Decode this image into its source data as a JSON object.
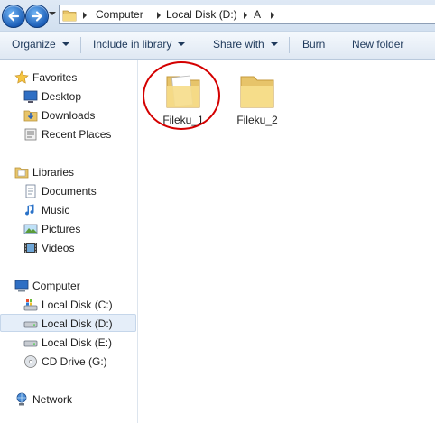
{
  "address_bar": {
    "breadcrumbs": [
      "Computer",
      "Local Disk (D:)",
      "A"
    ]
  },
  "command_bar": {
    "organize": "Organize",
    "include_in_library": "Include in library",
    "share_with": "Share with",
    "burn": "Burn",
    "new_folder": "New folder"
  },
  "nav_pane": {
    "favorites": {
      "label": "Favorites",
      "items": [
        "Desktop",
        "Downloads",
        "Recent Places"
      ]
    },
    "libraries": {
      "label": "Libraries",
      "items": [
        "Documents",
        "Music",
        "Pictures",
        "Videos"
      ]
    },
    "computer": {
      "label": "Computer",
      "items": [
        "Local Disk (C:)",
        "Local Disk (D:)",
        "Local Disk (E:)",
        "CD Drive (G:)"
      ],
      "selected": "Local Disk (D:)"
    },
    "network": {
      "label": "Network"
    }
  },
  "files": [
    {
      "name": "Fileku_1",
      "highlighted": true,
      "icon": "folder-with-document-icon"
    },
    {
      "name": "Fileku_2",
      "highlighted": false,
      "icon": "folder-icon"
    }
  ],
  "colors": {
    "highlight_circle": "#d40000",
    "accent": "#1d5fb8"
  }
}
